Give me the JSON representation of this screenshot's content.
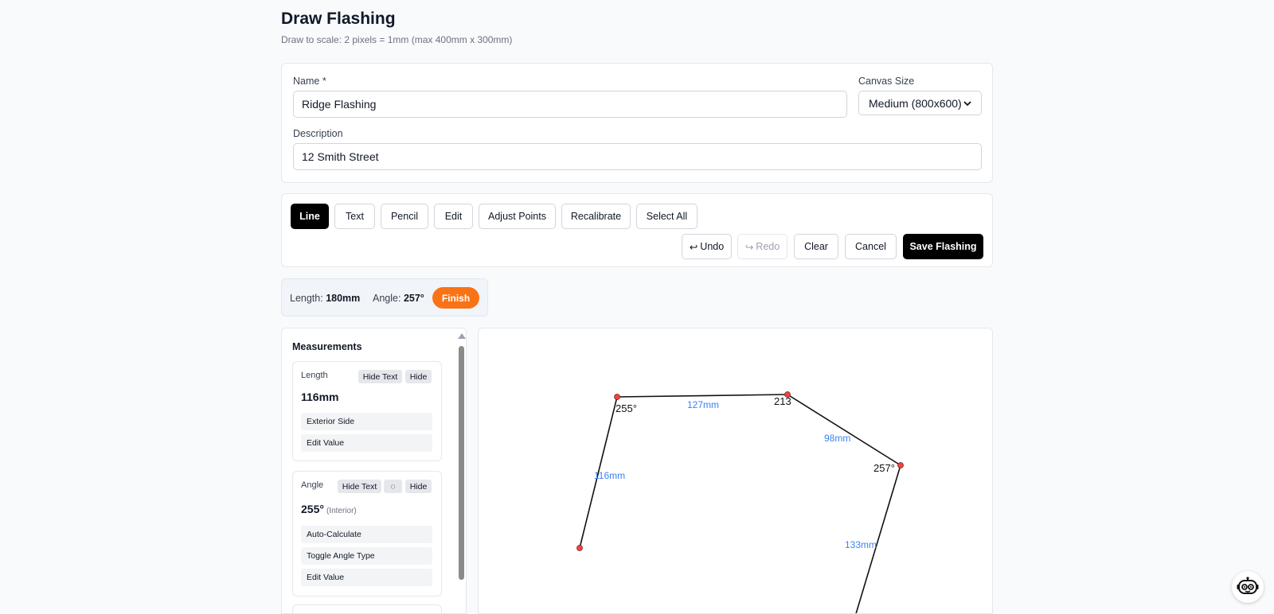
{
  "header": {
    "title": "Draw Flashing",
    "subtitle": "Draw to scale: 2 pixels = 1mm (max 400mm x 300mm)"
  },
  "form": {
    "name_label": "Name *",
    "name_value": "Ridge Flashing",
    "canvas_size_label": "Canvas Size",
    "canvas_size_value": "Medium (800x600)",
    "description_label": "Description",
    "description_value": "12 Smith Street"
  },
  "toolbar": {
    "tools": [
      "Line",
      "Text",
      "Pencil",
      "Edit",
      "Adjust Points",
      "Recalibrate",
      "Select All"
    ],
    "active_tool": "Line",
    "undo_label": "Undo",
    "redo_label": "Redo",
    "clear_label": "Clear",
    "cancel_label": "Cancel",
    "save_label": "Save Flashing"
  },
  "status": {
    "length_label": "Length:",
    "length_value": "180mm",
    "angle_label": "Angle:",
    "angle_value": "257°",
    "finish_label": "Finish"
  },
  "measurements": {
    "title": "Measurements",
    "length_card": {
      "label": "Length",
      "hide_text": "Hide Text",
      "hide": "Hide",
      "value": "116mm",
      "rows": [
        "Exterior Side",
        "Edit Value"
      ]
    },
    "angle_card": {
      "label": "Angle",
      "hide_text": "Hide Text",
      "toggle_symbol": "◌",
      "hide": "Hide",
      "value": "255°",
      "type": "(Interior)",
      "rows": [
        "Auto-Calculate",
        "Toggle Angle Type",
        "Edit Value"
      ]
    }
  },
  "canvas": {
    "labels": {
      "seg1": "116mm",
      "seg2": "127mm",
      "seg3": "98mm",
      "seg4": "133mm",
      "angle1": "255°",
      "angle2": "213",
      "angle3": "257°"
    },
    "line_color": "#111111",
    "point_color": "#ef4444",
    "label_color": "#3b82f6"
  },
  "colors": {
    "accent": "#000000",
    "finish": "#f97316"
  }
}
